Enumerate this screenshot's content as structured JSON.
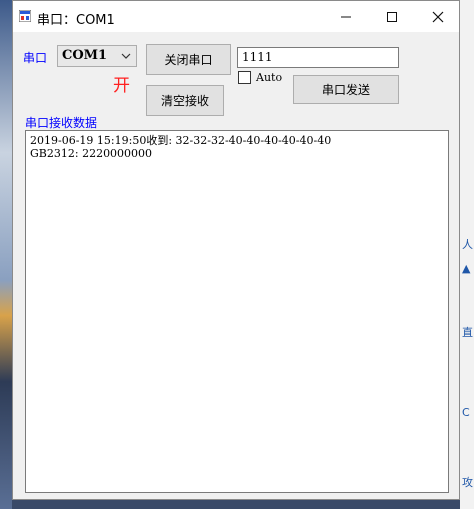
{
  "window": {
    "title": "串口：COM1",
    "controls": {
      "minimize": "—",
      "maximize": "☐",
      "close": "✕"
    }
  },
  "serial": {
    "port_label": "串口",
    "port_value": "COM1",
    "status": "开"
  },
  "buttons": {
    "close_port": "关闭串口",
    "clear_receive": "清空接收",
    "send": "串口发送"
  },
  "send": {
    "value": "1111",
    "auto_label": "Auto",
    "auto_checked": false
  },
  "receive": {
    "label": "串口接收数据",
    "lines": [
      "2019-06-19 15:19:50收到: 32-32-32-40-40-40-40-40-40",
      "GB2312: 2220000000"
    ]
  },
  "desktop_right_glyphs": [
    "人",
    "▲",
    "直",
    "C",
    "攻"
  ]
}
